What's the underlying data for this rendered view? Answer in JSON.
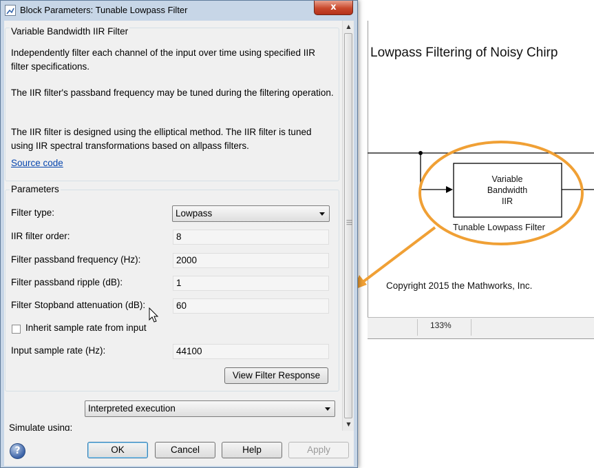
{
  "dialog": {
    "title": "Block Parameters: Tunable Lowpass Filter",
    "close_glyph": "x",
    "description_group": {
      "title": "Variable Bandwidth IIR Filter",
      "paragraphs": [
        "Independently filter each channel of the input over time using specified IIR filter specifications.",
        "The IIR filter's passband frequency may be tuned during the filtering operation.",
        "The IIR filter is designed using the elliptical method. The IIR filter is tuned using IIR spectral transformations based on allpass filters."
      ],
      "source_link": "Source code"
    },
    "parameters_group": {
      "title": "Parameters",
      "filter_type": {
        "label": "Filter type:",
        "value": "Lowpass"
      },
      "filter_order": {
        "label": "IIR filter order:",
        "value": "8"
      },
      "passband_frequency": {
        "label": "Filter passband frequency (Hz):",
        "value": "2000"
      },
      "passband_ripple": {
        "label": "Filter passband ripple (dB):",
        "value": "1"
      },
      "stopband_attenuation": {
        "label": "Filter Stopband attenuation (dB):",
        "value": "60"
      },
      "inherit_sample_rate": {
        "label": "Inherit sample rate from input",
        "checked": false
      },
      "input_sample_rate": {
        "label": "Input sample rate (Hz):",
        "value": "44100"
      },
      "view_response_button": "View Filter Response"
    },
    "simulate": {
      "label": "Simulate using:",
      "value": "Interpreted execution"
    },
    "buttons": {
      "ok": "OK",
      "cancel": "Cancel",
      "help": "Help",
      "apply": "Apply",
      "apply_enabled": false
    },
    "help_icon_glyph": "?"
  },
  "model": {
    "title": "Lowpass Filtering of Noisy Chirp",
    "block": {
      "lines": [
        "Variable",
        "Bandwidth",
        "IIR"
      ],
      "name": "Tunable Lowpass Filter"
    },
    "copyright": "Copyright 2015 the Mathworks, Inc.",
    "zoom": "133%"
  },
  "colors": {
    "highlight_orange": "#f0a035",
    "dialog_frame": "#c7d6e7",
    "link": "#0645ad"
  }
}
